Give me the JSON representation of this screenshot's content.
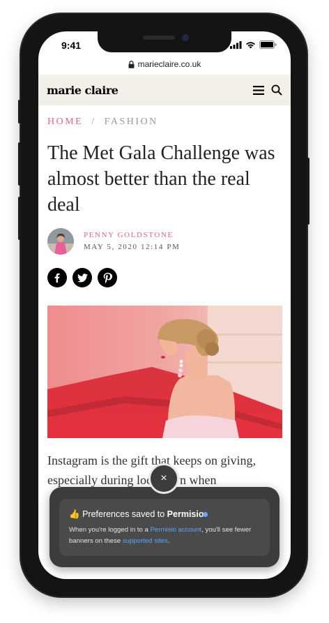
{
  "status_bar": {
    "time": "9:41"
  },
  "browser": {
    "url": "marieclaire.co.uk"
  },
  "site": {
    "logo": "marie claire"
  },
  "breadcrumb": {
    "home": "HOME",
    "separator": "/",
    "section": "FASHION"
  },
  "article": {
    "title": "The Met Gala Challenge was almost better than the real deal",
    "author": "PENNY GOLDSTONE",
    "date": "MAY 5, 2020 12:14 PM",
    "body_start": "Instagram is the gift that keeps on giving, especially during lockdown when"
  },
  "share": {
    "icons": [
      "facebook-icon",
      "twitter-icon",
      "pinterest-icon"
    ]
  },
  "toast": {
    "emoji": "👍",
    "title_prefix": "Preferences saved to",
    "brand": "Permisio",
    "body_1": "When you're logged in to a",
    "link_account": "Permisio account",
    "body_2": ", you'll see fewer banners on these",
    "link_sites": "supported sites",
    "body_3": ".",
    "close": "×"
  },
  "colors": {
    "accent_pink": "#e06a7a",
    "toast_bg": "#3c3c3c",
    "link_blue": "#5aa7ff",
    "header_bg": "#f1efe8"
  }
}
